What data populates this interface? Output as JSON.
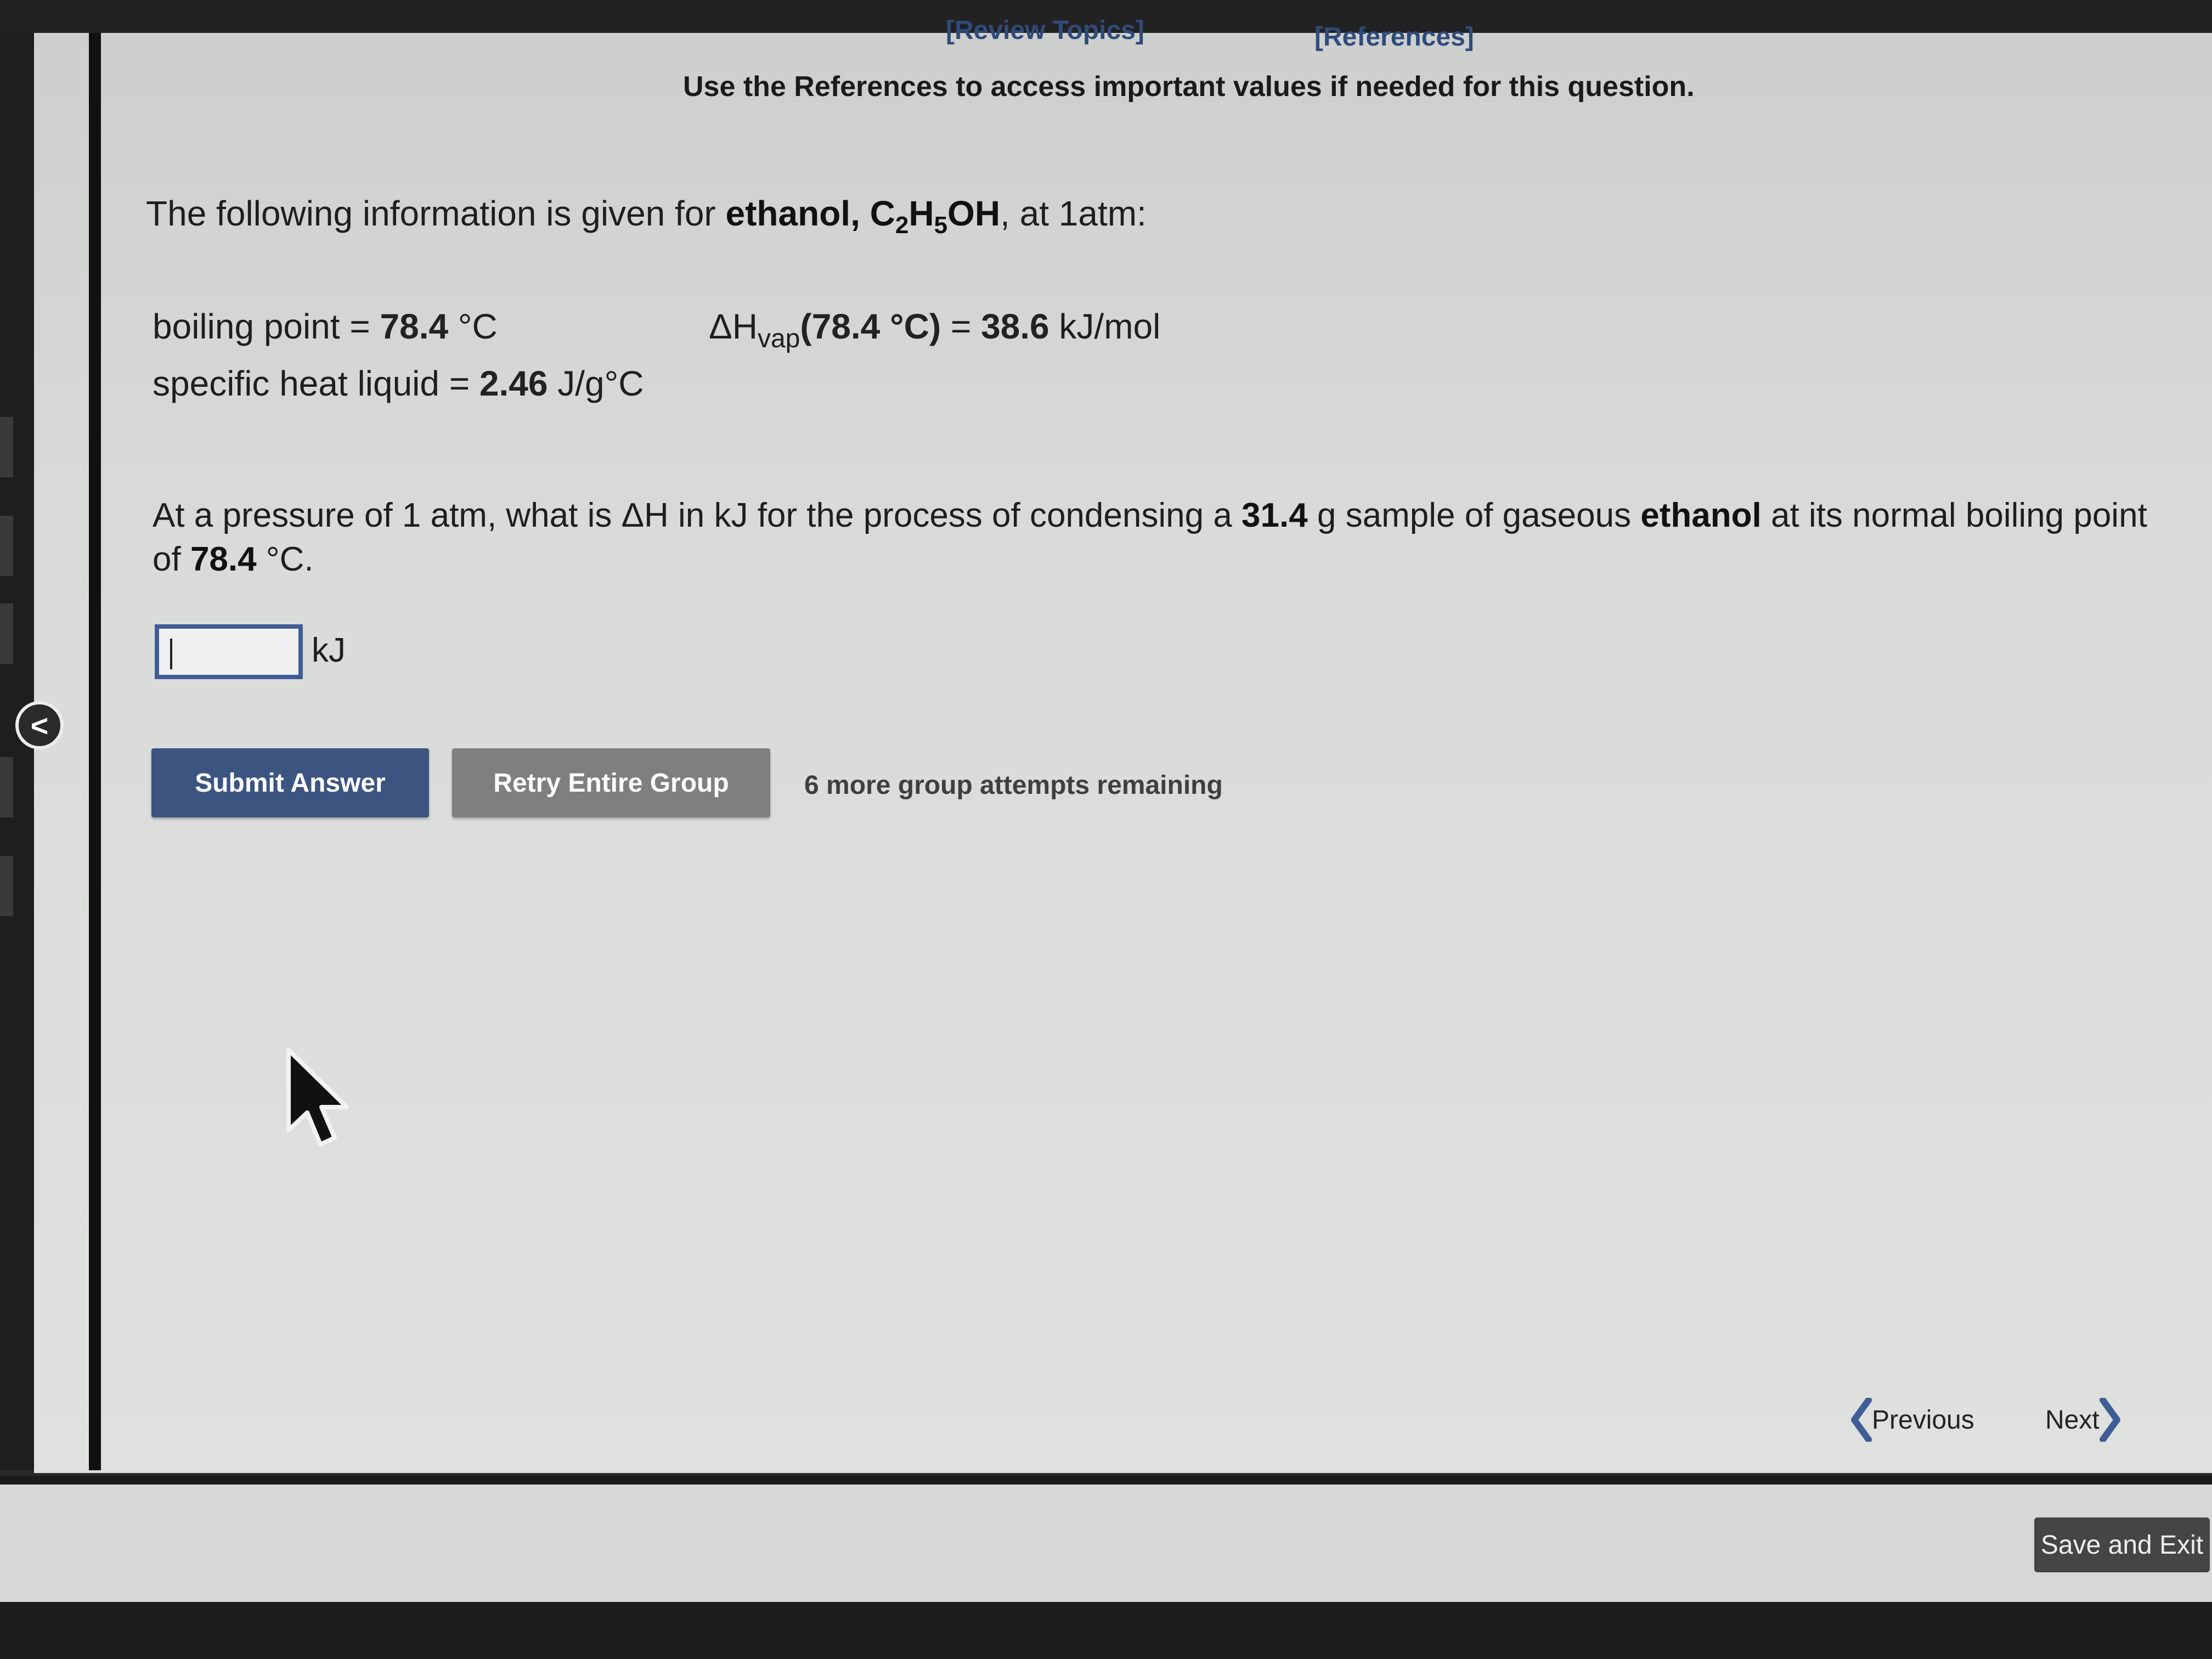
{
  "header": {
    "review_topics": "[Review Topics]",
    "references": "[References]",
    "note": "Use the References to access important values if needed for this question."
  },
  "question": {
    "intro_prefix": "The following information is given for ",
    "substance": "ethanol, ",
    "formula": [
      "C",
      "2",
      "H",
      "5",
      "OH"
    ],
    "intro_suffix": ", at 1atm:",
    "boiling_point_label": "boiling point = ",
    "boiling_point_value": "78.4",
    "boiling_point_unit": " °C",
    "specific_heat_label": "specific heat liquid = ",
    "specific_heat_value": "2.46",
    "specific_heat_unit": " J/g°C",
    "dh_symbol": "ΔH",
    "dh_sub": "vap",
    "dh_paren": "(78.4 °C)",
    "dh_eq": " = ",
    "dh_value": "38.6",
    "dh_unit": " kJ/mol",
    "prompt_1": "At a pressure of 1 atm, what is ΔH in kJ for the process of condensing a ",
    "prompt_mass": "31.4",
    "prompt_2": " g sample of gaseous ",
    "prompt_substance": "ethanol",
    "prompt_3": " at its normal boiling point of ",
    "prompt_temp": "78.4",
    "prompt_4": " °C."
  },
  "answer": {
    "value": "",
    "unit": "kJ"
  },
  "actions": {
    "submit": "Submit Answer",
    "retry": "Retry Entire Group",
    "attempts": "6 more group attempts remaining"
  },
  "navigation": {
    "previous": "Previous",
    "next": "Next",
    "save_exit": "Save and Exit",
    "collapse": "<"
  },
  "colors": {
    "link": "#2f4b7c",
    "submit_bg": "#3c5480",
    "retry_bg": "#7f7f7f",
    "nav_chevron": "#3f5d96"
  },
  "icons": [
    "collapse-icon",
    "mouse-pointer-icon",
    "chevron-left-icon",
    "chevron-right-icon"
  ]
}
